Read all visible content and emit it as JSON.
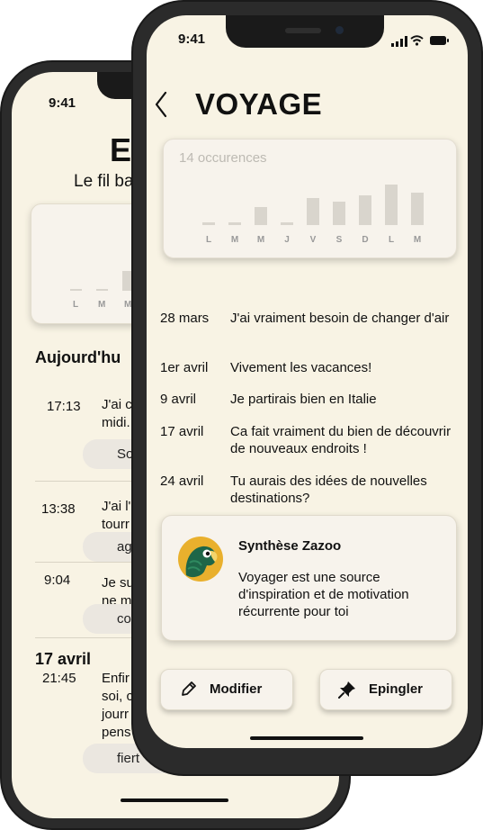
{
  "back_screen": {
    "status_time": "9:41",
    "title": "E",
    "subtitle": "Le fil ba",
    "chart": {
      "day_labels": [
        "L",
        "M",
        "M"
      ],
      "bar_values": [
        0.02,
        0.02,
        0.5
      ]
    },
    "section_today": "Aujourd'hu",
    "entries": [
      {
        "time": "17:13",
        "text": "J'ai c\nmidi.",
        "tag": "So"
      },
      {
        "time": "13:38",
        "text": "J'ai l'\ntourr",
        "tag": "ag"
      },
      {
        "time": "9:04",
        "text": "Je su\nne m",
        "tag": "co"
      }
    ],
    "section_date": "17 avril",
    "last_entry": {
      "time": "21:45",
      "text": "Enfir\nsoi, c\njourr\npens",
      "tag": "fiert"
    }
  },
  "front_screen": {
    "status_time": "9:41",
    "title": "VOYAGE",
    "chart": {
      "type": "bar",
      "occurrences_label": "14 occurences",
      "categories": [
        "L",
        "M",
        "M",
        "J",
        "V",
        "S",
        "D",
        "L",
        "M"
      ],
      "values": [
        0.1,
        0.1,
        0.65,
        0.1,
        1,
        0.85,
        1.1,
        1.5,
        1.2
      ],
      "color": "#d9d5cd"
    },
    "entries": [
      {
        "date": "28 mars",
        "text": "J'ai vraiment besoin de changer d'air"
      },
      {
        "date": "1er avril",
        "text": "Vivement les vacances!"
      },
      {
        "date": "9 avril",
        "text": "Je partirais bien en Italie"
      },
      {
        "date": "17 avril",
        "text": "Ca fait vraiment du bien de découvrir de nouveaux endroits !"
      },
      {
        "date": "24 avril",
        "text": "Tu aurais des idées de nouvelles destinations?"
      }
    ],
    "synthesis": {
      "title": "Synthèse Zazoo",
      "text": "Voyager est une source d'inspiration et de motivation récurrente pour toi",
      "avatar_icon": "parrot-icon",
      "avatar_bg": "#e9b02d",
      "avatar_color": "#1e6648"
    },
    "buttons": {
      "modify": {
        "label": "Modifier",
        "icon": "pencil-icon"
      },
      "pin": {
        "label": "Epingler",
        "icon": "pin-icon"
      }
    }
  }
}
